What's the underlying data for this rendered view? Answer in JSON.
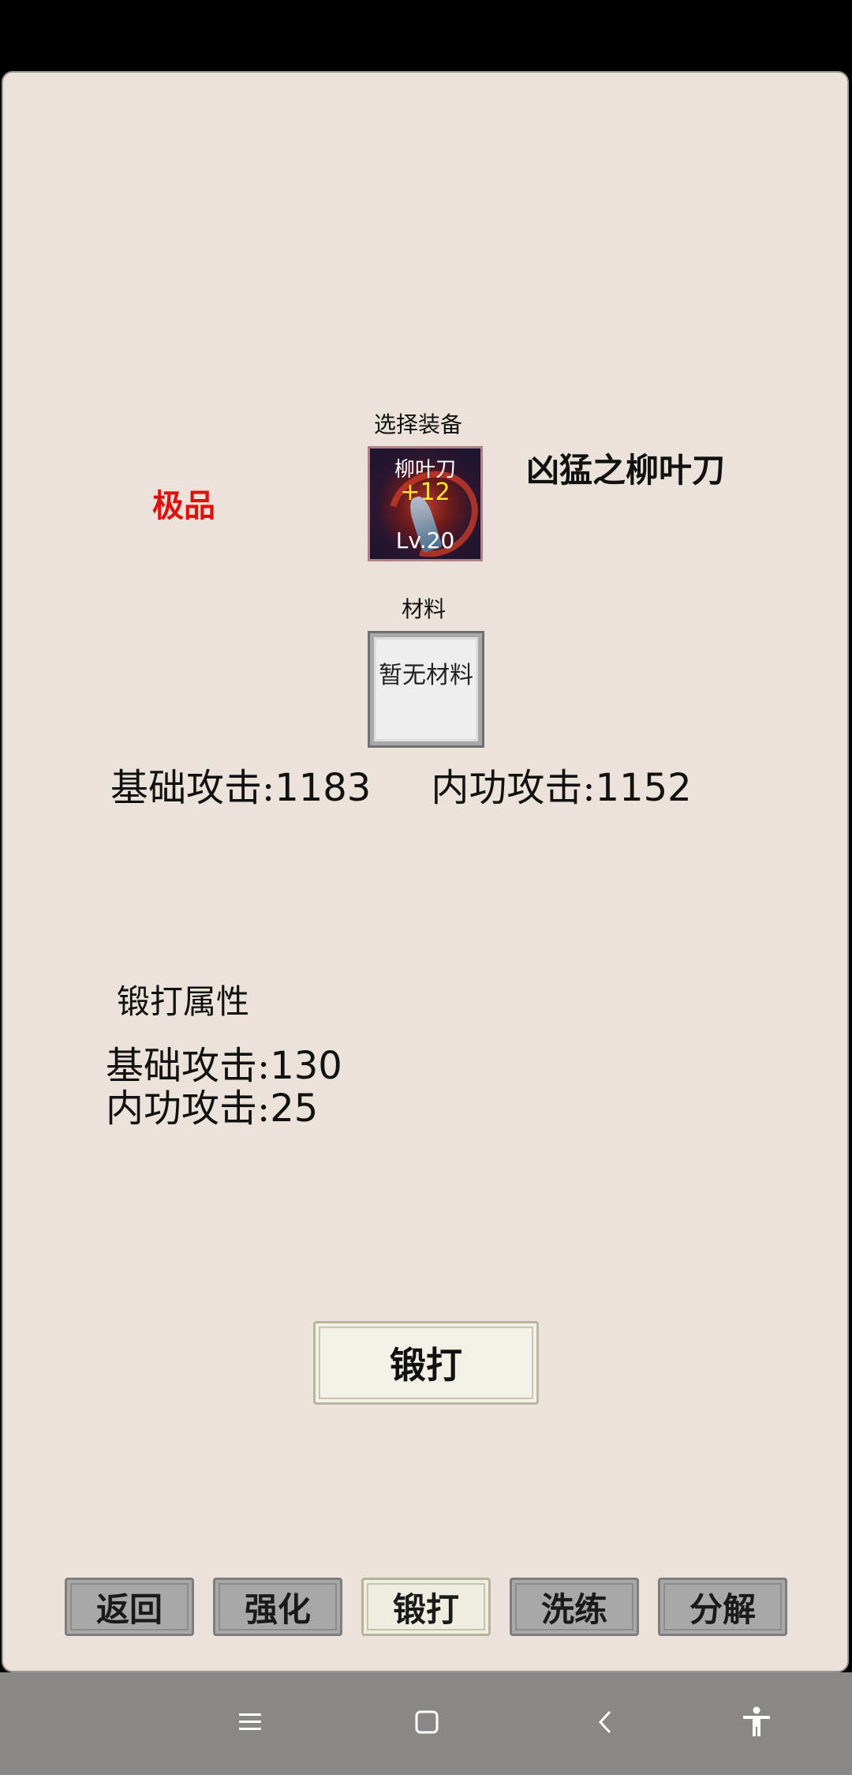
{
  "equipment": {
    "select_label": "选择装备",
    "grade": "极品",
    "item_name": "凶猛之柳叶刀",
    "slot_name": "柳叶刀",
    "slot_plus": "+12",
    "slot_level": "Lv.20"
  },
  "material": {
    "label": "材料",
    "empty_text": "暂无材料"
  },
  "stats": {
    "base_attack_label": "基础攻击:",
    "base_attack_value": "1183",
    "inner_attack_label": "内功攻击:",
    "inner_attack_value": "1152"
  },
  "forge_attrs": {
    "title": "锻打属性",
    "base_attack_label": "基础攻击:",
    "base_attack_value": "130",
    "inner_attack_label": "内功攻击:",
    "inner_attack_value": "25"
  },
  "forge_button": "锻打",
  "tabs": [
    {
      "label": "返回"
    },
    {
      "label": "强化"
    },
    {
      "label": "锻打",
      "active": true
    },
    {
      "label": "洗练"
    },
    {
      "label": "分解"
    }
  ],
  "colors": {
    "panel_bg": "#ebe3da",
    "grade": "#e01010",
    "plus": "#ffe82a"
  },
  "icons": [
    "menu-icon",
    "home-icon",
    "back-icon",
    "accessibility-icon"
  ]
}
